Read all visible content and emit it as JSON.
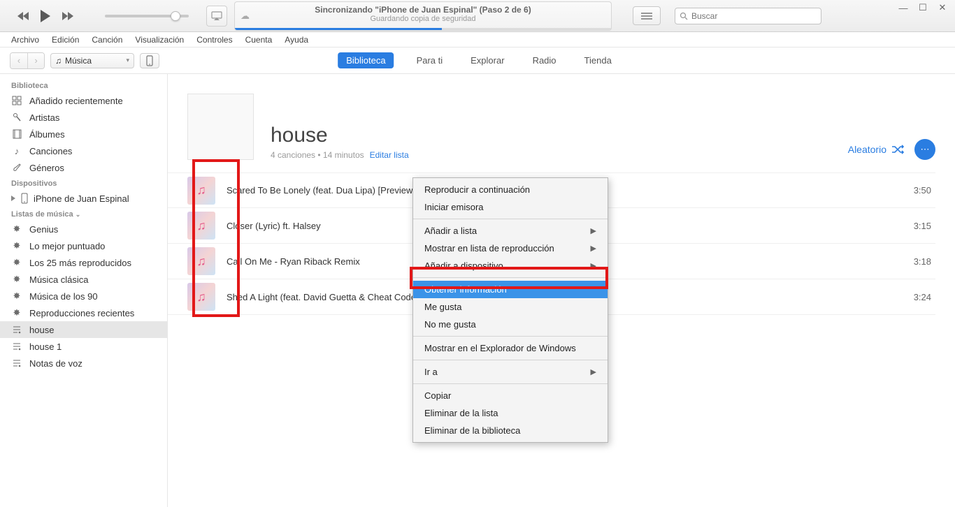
{
  "player": {
    "lcd_title": "Sincronizando \"iPhone de Juan Espinal\" (Paso 2 de 6)",
    "lcd_subtitle": "Guardando copia de seguridad"
  },
  "search": {
    "placeholder": "Buscar"
  },
  "menubar": [
    "Archivo",
    "Edición",
    "Canción",
    "Visualización",
    "Controles",
    "Cuenta",
    "Ayuda"
  ],
  "media_select": "Música",
  "tabs": [
    {
      "label": "Biblioteca",
      "active": true
    },
    {
      "label": "Para ti",
      "active": false
    },
    {
      "label": "Explorar",
      "active": false
    },
    {
      "label": "Radio",
      "active": false
    },
    {
      "label": "Tienda",
      "active": false
    }
  ],
  "sidebar": {
    "library_header": "Biblioteca",
    "library": [
      {
        "label": "Añadido recientemente",
        "icon": "grid"
      },
      {
        "label": "Artistas",
        "icon": "mic"
      },
      {
        "label": "Álbumes",
        "icon": "album"
      },
      {
        "label": "Canciones",
        "icon": "note"
      },
      {
        "label": "Géneros",
        "icon": "guitar"
      }
    ],
    "devices_header": "Dispositivos",
    "devices": [
      {
        "label": "iPhone de Juan Espinal"
      }
    ],
    "playlists_header": "Listas de música",
    "playlists": [
      {
        "label": "Genius",
        "icon": "gear"
      },
      {
        "label": "Lo mejor puntuado",
        "icon": "gear"
      },
      {
        "label": "Los 25 más reproducidos",
        "icon": "gear"
      },
      {
        "label": "Música clásica",
        "icon": "gear"
      },
      {
        "label": "Música de los 90",
        "icon": "gear"
      },
      {
        "label": "Reproducciones recientes",
        "icon": "gear"
      },
      {
        "label": "house",
        "icon": "list",
        "selected": true
      },
      {
        "label": "house 1",
        "icon": "list"
      },
      {
        "label": "Notas de voz",
        "icon": "list"
      }
    ]
  },
  "playlist": {
    "title": "house",
    "meta": "4 canciones • 14 minutos",
    "edit": "Editar lista",
    "shuffle": "Aleatorio",
    "tracks": [
      {
        "title": "Scared To Be Lonely (feat. Dua Lipa) [Preview]",
        "dur": "3:50"
      },
      {
        "title": "Closer (Lyric) ft. Halsey",
        "dur": "3:15"
      },
      {
        "title": "Call On Me - Ryan Riback Remix",
        "dur": "3:18"
      },
      {
        "title": "Shed A Light (feat. David Guetta & Cheat Codes)",
        "dur": "3:24"
      }
    ]
  },
  "context_menu": {
    "items": [
      {
        "label": "Reproducir a continuación"
      },
      {
        "label": "Iniciar emisora"
      },
      {
        "sep": true
      },
      {
        "label": "Añadir a lista",
        "sub": true
      },
      {
        "label": "Mostrar en lista de reproducción",
        "sub": true
      },
      {
        "label": "Añadir a dispositivo",
        "sub": true
      },
      {
        "sep": true
      },
      {
        "label": "Obtener información",
        "highlight": true
      },
      {
        "label": "Me gusta"
      },
      {
        "label": "No me gusta"
      },
      {
        "sep": true
      },
      {
        "label": "Mostrar en el Explorador de Windows"
      },
      {
        "sep": true
      },
      {
        "label": "Ir a",
        "sub": true
      },
      {
        "sep": true
      },
      {
        "label": "Copiar"
      },
      {
        "label": "Eliminar de la lista"
      },
      {
        "label": "Eliminar de la biblioteca"
      }
    ]
  }
}
